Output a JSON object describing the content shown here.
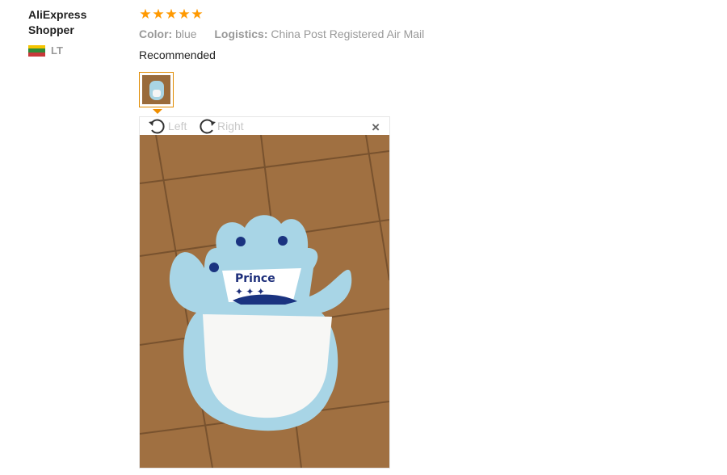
{
  "reviewer": {
    "name": "AliExpress Shopper",
    "country_code": "LT",
    "flag_colors": [
      "#f5c400",
      "#2f8b3a",
      "#c8383a"
    ]
  },
  "review": {
    "rating": 5,
    "stars": [
      "★",
      "★",
      "★",
      "★",
      "★"
    ],
    "color_label": "Color:",
    "color_value": "blue",
    "logistics_label": "Logistics:",
    "logistics_value": "China Post Registered Air Mail",
    "feedback": "Recommended",
    "accent_color": "#ff9900"
  },
  "viewer": {
    "rotate_left_label": "Left",
    "rotate_right_label": "Right",
    "close_label": "×",
    "photo_text": "Prince"
  }
}
